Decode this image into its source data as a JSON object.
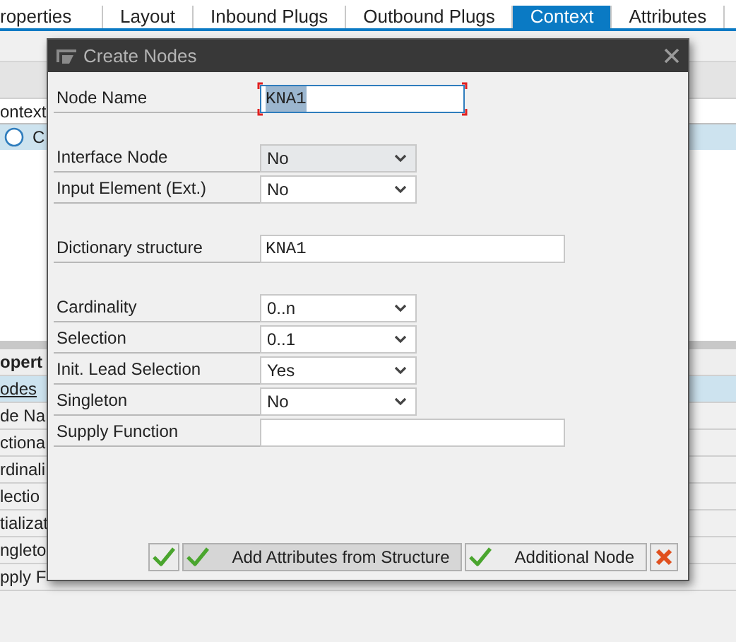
{
  "tabs": [
    {
      "label": "roperties",
      "selected": false
    },
    {
      "label": "Layout",
      "selected": false
    },
    {
      "label": "Inbound Plugs",
      "selected": false
    },
    {
      "label": "Outbound Plugs",
      "selected": false
    },
    {
      "label": "Context",
      "selected": true
    },
    {
      "label": "Attributes",
      "selected": false
    }
  ],
  "context_panel": {
    "header": "ontext",
    "rows": [
      {
        "label": "C",
        "selected": true
      }
    ]
  },
  "properties_panel": {
    "header": "opert",
    "rows": [
      {
        "label": "odes",
        "selected": true
      },
      {
        "label": "de Na",
        "selected": false
      },
      {
        "label": "ctiona",
        "selected": false
      },
      {
        "label": "rdinali",
        "selected": false
      },
      {
        "label": "lectio",
        "selected": false
      },
      {
        "label": "tializat",
        "selected": false
      },
      {
        "label": "ngleto",
        "selected": false
      },
      {
        "label": "pply F",
        "selected": false
      }
    ]
  },
  "dialog": {
    "title": "Create Nodes",
    "groups": [
      [
        {
          "label": "Node Name",
          "kind": "text",
          "value": "KNA1",
          "focused": true
        }
      ],
      [
        {
          "label": "Interface Node",
          "kind": "dropdown",
          "value": "No",
          "disabled": true
        },
        {
          "label": "Input Element (Ext.)",
          "kind": "dropdown",
          "value": "No",
          "disabled": false
        }
      ],
      [
        {
          "label": "Dictionary structure",
          "kind": "text",
          "value": "KNA1",
          "focused": false
        }
      ],
      [
        {
          "label": "Cardinality",
          "kind": "dropdown",
          "value": "0..n",
          "disabled": false
        },
        {
          "label": "Selection",
          "kind": "dropdown",
          "value": "0..1",
          "disabled": false
        },
        {
          "label": "Init. Lead Selection",
          "kind": "dropdown",
          "value": "Yes",
          "disabled": false
        },
        {
          "label": "Singleton",
          "kind": "dropdown",
          "value": "No",
          "disabled": false
        },
        {
          "label": "Supply Function",
          "kind": "text",
          "focused": false
        }
      ]
    ],
    "buttons": [
      {
        "kind": "ok"
      },
      {
        "kind": "ok",
        "label": "Add Attributes from Structure",
        "pressed": true
      },
      {
        "kind": "ok",
        "label": "Additional Node",
        "pressed": false
      },
      {
        "kind": "cancel"
      }
    ]
  }
}
